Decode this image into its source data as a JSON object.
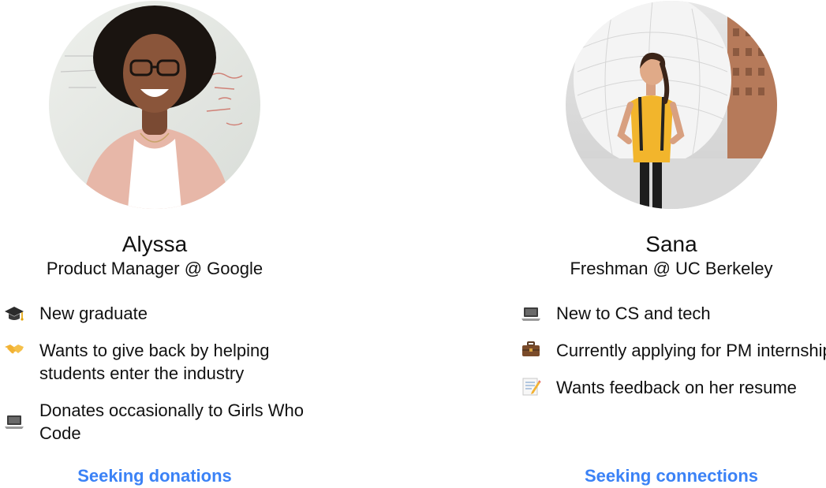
{
  "accent_color": "#3b82f6",
  "personas": [
    {
      "name": "Alyssa",
      "role": "Product Manager @ Google",
      "traits": [
        {
          "icon": "graduation-cap-icon",
          "text": "New graduate"
        },
        {
          "icon": "handshake-icon",
          "text": "Wants to give back by helping students enter the industry"
        },
        {
          "icon": "laptop-icon",
          "text": "Donates occasionally to Girls Who Code"
        }
      ],
      "cta": "Seeking donations"
    },
    {
      "name": "Sana",
      "role": "Freshman @ UC Berkeley",
      "traits": [
        {
          "icon": "laptop-icon",
          "text": "New to CS and tech"
        },
        {
          "icon": "briefcase-icon",
          "text": "Currently applying for PM internships"
        },
        {
          "icon": "memo-icon",
          "text": "Wants feedback on her resume"
        }
      ],
      "cta": "Seeking connections"
    }
  ]
}
